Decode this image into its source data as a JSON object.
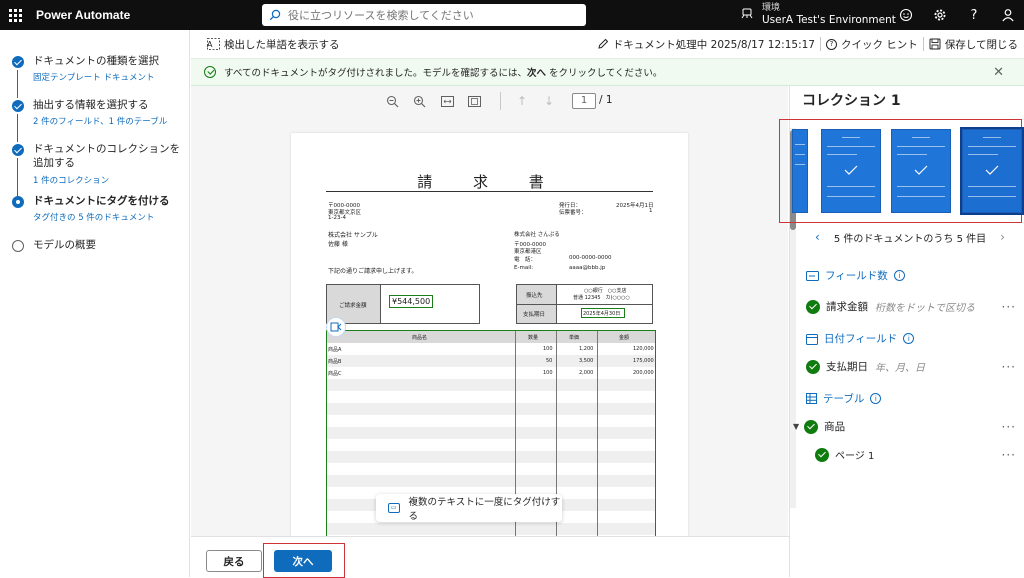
{
  "app": {
    "title": "Power Automate",
    "search_placeholder": "役に立つリソースを検索してください",
    "env_label": "環境",
    "env_name": "UserA Test's Environment"
  },
  "icons": {
    "waffle": "app-launcher-icon",
    "search": "search-icon",
    "env": "environment-icon",
    "smiley": "feedback-icon",
    "gear": "gear-icon",
    "help": "help-icon",
    "user": "person-icon"
  },
  "steps": [
    {
      "title": "ドキュメントの種類を選択",
      "sub": "固定テンプレート ドキュメント",
      "state": "done"
    },
    {
      "title": "抽出する情報を選択する",
      "sub": "2 件のフィールド、1 件のテーブル",
      "state": "done"
    },
    {
      "title": "ドキュメントのコレクションを追加する",
      "title_line1": "ドキュメントのコレクションを",
      "title_line2": "追加する",
      "sub": "1 件のコレクション",
      "state": "done"
    },
    {
      "title": "ドキュメントにタグを付ける",
      "sub": "タグ付きの 5 件のドキュメント",
      "state": "current"
    },
    {
      "title": "モデルの概要",
      "sub": "",
      "state": "todo"
    }
  ],
  "toolbar": {
    "show_words": "検出した単語を表示する",
    "processing": "ドキュメント処理中 2025/8/17 12:15:17",
    "quick_hint": "クイック ヒント",
    "save_close": "保存して閉じる"
  },
  "banner": {
    "text_before": "すべてのドキュメントがタグ付けされました。モデルを確認するには、",
    "text_bold": "次へ",
    "text_after": " をクリックしてください。"
  },
  "viewer": {
    "page_current": "1",
    "page_total": "/ 1",
    "multi_tag_label": "複数のテキストに一度にタグ付けする"
  },
  "invoice": {
    "title": "請 求 書",
    "zip1": "〒000-0000",
    "addr1": "東京都文京区",
    "addr2": "1-23-4",
    "issue_label": "発行日：",
    "issue_date": "2025年4月1日",
    "invoice_no_label": "伝票番号：",
    "invoice_no": "1",
    "customer": "株式会社 サンプル",
    "customer_person": "佐藤 様",
    "vendor": "株式会社 さんぷる",
    "vendor_zip": "〒000-0000",
    "vendor_addr": "東京都港区",
    "tel_label": "電　話：",
    "tel": "000-0000-0000",
    "email_label": "E-mail:",
    "email": "aaaa@bbb.jp",
    "greeting": "下記の通りご請求申し上げます。",
    "amount_label": "ご請求金額",
    "amount": "¥544,500",
    "bank_label": "振込先",
    "bank_line1": "○○銀行　○○支店",
    "bank_line2": "普通 12345　カ)○○○○",
    "due_label": "支払期日",
    "due_date": "2025年4月30日",
    "col_item": "商品名",
    "col_qty": "数量",
    "col_price": "単価",
    "col_amount": "金額",
    "rows": [
      {
        "item": "商品A",
        "qty": "100",
        "price": "1,200",
        "amount": "120,000"
      },
      {
        "item": "商品B",
        "qty": "50",
        "price": "3,500",
        "amount": "175,000"
      },
      {
        "item": "商品C",
        "qty": "100",
        "price": "2,000",
        "amount": "200,000"
      }
    ]
  },
  "footer": {
    "back": "戻る",
    "next": "次へ"
  },
  "panel": {
    "title": "コレクション 1",
    "nav_text": "5 件のドキュメントのうち 5 件目",
    "fields_header": "フィールド数",
    "field1_name": "請求金額",
    "field1_hint": "桁数をドットで区切る",
    "date_header": "日付フィールド",
    "field2_name": "支払期日",
    "field2_hint": "年、月、日",
    "table_header": "テーブル",
    "table_name": "商品",
    "page_name": "ページ 1",
    "more": "···"
  },
  "colors": {
    "accent": "#0f6cbd",
    "success": "#107c10",
    "highlight_border": "#d13438",
    "topbar": "#0f0f0f"
  }
}
